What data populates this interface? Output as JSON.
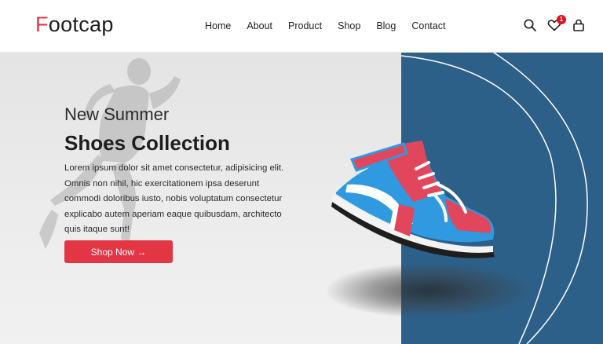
{
  "brand": {
    "first_letter": "F",
    "rest": "ootcap",
    "accent": "#e23645"
  },
  "nav": {
    "items": [
      {
        "label": "Home"
      },
      {
        "label": "About"
      },
      {
        "label": "Product"
      },
      {
        "label": "Shop"
      },
      {
        "label": "Blog"
      },
      {
        "label": "Contact"
      }
    ]
  },
  "header_actions": {
    "icons": [
      "search-icon",
      "heart-icon",
      "shopping-bag-icon"
    ],
    "wishlist_count": "1"
  },
  "hero": {
    "subtitle": "New Summer",
    "title": "Shoes Collection",
    "description": "Lorem ipsum dolor sit amet consectetur, adipisicing elit. Omnis non nihil, hic exercitationem ipsa deserunt commodi doloribus iusto, nobis voluptatum consectetur explicabo autem aperiam eaque quibusdam, architecto quis itaque sunt!",
    "cta_label": "Shop Now →",
    "panel_color": "#2d6088"
  }
}
